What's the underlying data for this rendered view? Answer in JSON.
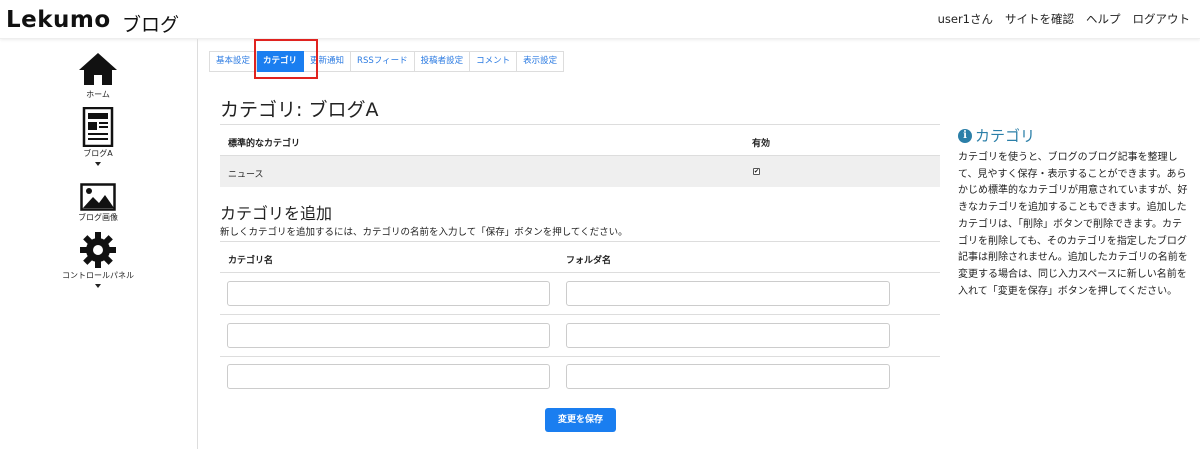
{
  "header": {
    "logo": "Lekumo",
    "logo_sub": "ブログ",
    "nav": {
      "user": "user1さん",
      "view_site": "サイトを確認",
      "help": "ヘルプ",
      "logout": "ログアウト"
    }
  },
  "sidebar": {
    "home": "ホーム",
    "blog": "ブログA",
    "images": "ブログ画像",
    "control_panel": "コントロールパネル"
  },
  "tabs": [
    "基本設定",
    "カテゴリ",
    "更新通知",
    "RSSフィード",
    "投稿者設定",
    "コメント",
    "表示設定"
  ],
  "active_tab": "カテゴリ",
  "main": {
    "title": "カテゴリ: ブログA",
    "table": {
      "col_category": "標準的なカテゴリ",
      "col_enabled": "有効",
      "rows": [
        {
          "name": "ニュース",
          "enabled": true
        }
      ]
    },
    "add_title": "カテゴリを追加",
    "add_desc": "新しくカテゴリを追加するには、カテゴリの名前を入力して「保存」ボタンを押してください。",
    "form": {
      "col_name": "カテゴリ名",
      "col_folder": "フォルダ名",
      "rows": [
        {
          "name": "",
          "folder": ""
        },
        {
          "name": "",
          "folder": ""
        },
        {
          "name": "",
          "folder": ""
        }
      ]
    },
    "save_button": "変更を保存"
  },
  "help": {
    "title": "カテゴリ",
    "text": "カテゴリを使うと、ブログのブログ記事を整理して、見やすく保存・表示することができます。あらかじめ標準的なカテゴリが用意されていますが、好きなカテゴリを追加することもできます。追加したカテゴリは、「削除」ボタンで削除できます。カテゴリを削除しても、そのカテゴリを指定したブログ記事は削除されません。追加したカテゴリの名前を変更する場合は、同じ入力スペースに新しい名前を入れて「変更を保存」ボタンを押してください。"
  },
  "colors": {
    "accent": "#1a7ef0",
    "highlight": "#e0231f",
    "help_title": "#2b7fa8"
  }
}
